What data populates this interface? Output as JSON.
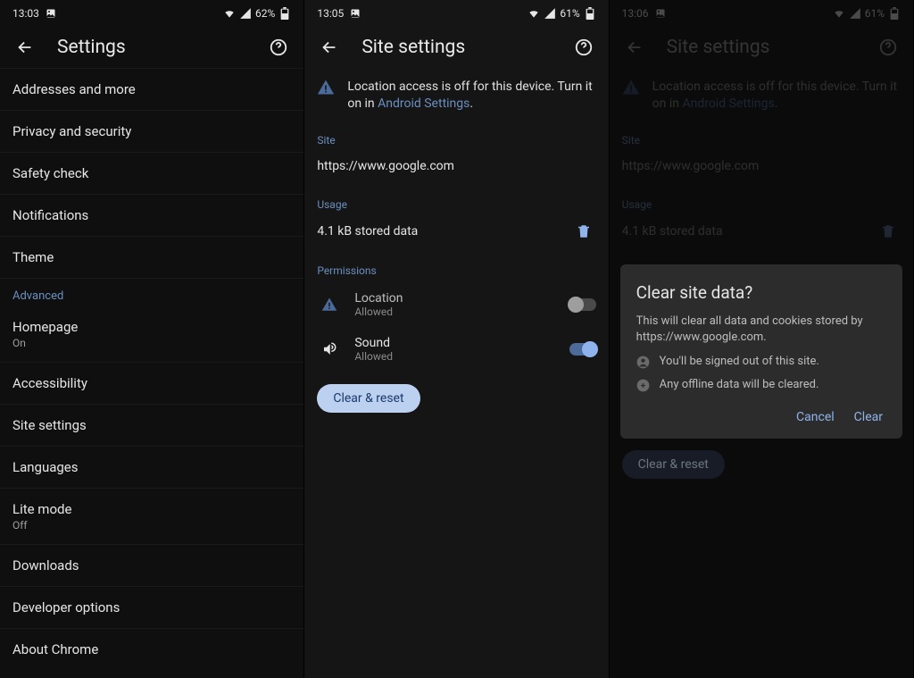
{
  "panes": {
    "p1": {
      "status": {
        "time": "13:03",
        "battery": "62%"
      },
      "title": "Settings",
      "items": [
        {
          "label": "Addresses and more"
        },
        {
          "label": "Privacy and security"
        },
        {
          "label": "Safety check"
        },
        {
          "label": "Notifications"
        },
        {
          "label": "Theme"
        }
      ],
      "advanced_label": "Advanced",
      "adv_items": [
        {
          "label": "Homepage",
          "sub": "On"
        },
        {
          "label": "Accessibility"
        },
        {
          "label": "Site settings"
        },
        {
          "label": "Languages"
        },
        {
          "label": "Lite mode",
          "sub": "Off"
        },
        {
          "label": "Downloads"
        },
        {
          "label": "Developer options"
        },
        {
          "label": "About Chrome"
        }
      ]
    },
    "p2": {
      "status": {
        "time": "13:05",
        "battery": "61%"
      },
      "title": "Site settings",
      "notice_pre": "Location access is off for this device. Turn it on in ",
      "notice_link": "Android Settings",
      "site_header": "Site",
      "site_value": "https://www.google.com",
      "usage_header": "Usage",
      "usage_value": "4.1 kB stored data",
      "perms_header": "Permissions",
      "perm_location": {
        "name": "Location",
        "state": "Allowed"
      },
      "perm_sound": {
        "name": "Sound",
        "state": "Allowed"
      },
      "clear_reset": "Clear & reset"
    },
    "p3": {
      "status": {
        "time": "13:06",
        "battery": "61%"
      },
      "title": "Site settings",
      "notice_pre": "Location access is off for this device. Turn it on in ",
      "notice_link": "Android Settings",
      "site_header": "Site",
      "site_value": "https://www.google.com",
      "usage_header": "Usage",
      "usage_value": "4.1 kB stored data",
      "clear_reset": "Clear & reset",
      "dialog": {
        "title": "Clear site data?",
        "body": "This will clear all data and cookies stored by https://www.google.com.",
        "bullet1": "You'll be signed out of this site.",
        "bullet2": "Any offline data will be cleared.",
        "cancel": "Cancel",
        "clear": "Clear"
      }
    }
  }
}
